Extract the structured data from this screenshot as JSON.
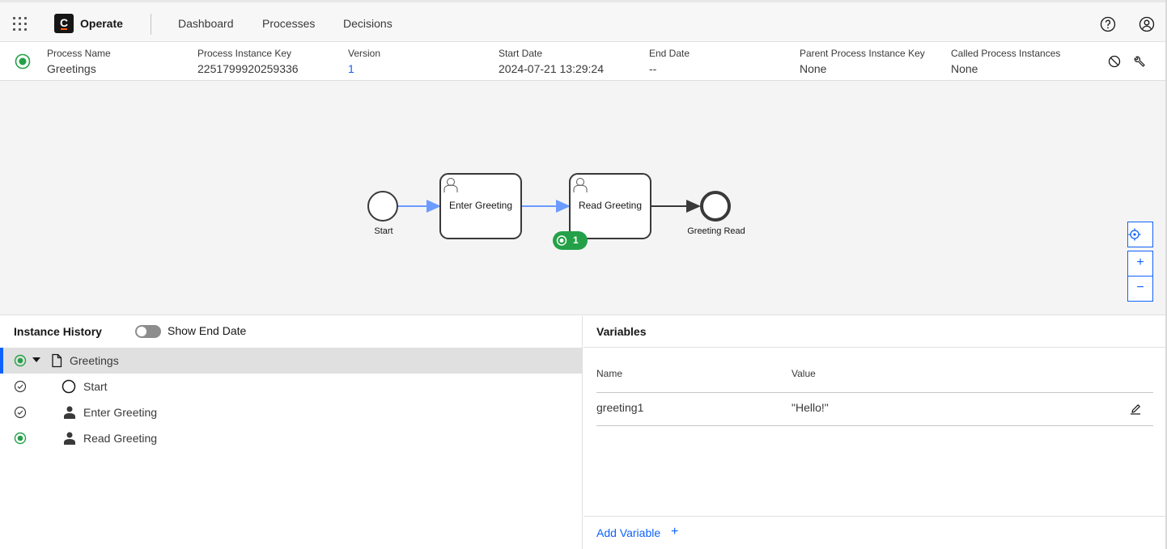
{
  "header": {
    "app_name": "Operate",
    "logo_letter": "C",
    "nav": [
      "Dashboard",
      "Processes",
      "Decisions"
    ],
    "icons": [
      "app-switcher-icon",
      "help-icon",
      "user-profile-icon"
    ]
  },
  "instance": {
    "status": "active",
    "fields": [
      {
        "label": "Process Name",
        "value": "Greetings"
      },
      {
        "label": "Process Instance Key",
        "value": "2251799920259336"
      },
      {
        "label": "Version",
        "value": "1"
      },
      {
        "label": "Start Date",
        "value": "2024-07-21 13:29:24"
      },
      {
        "label": "End Date",
        "value": "--"
      },
      {
        "label": "Parent Process Instance Key",
        "value": "None"
      },
      {
        "label": "Called Process Instances",
        "value": "None"
      }
    ],
    "actions": [
      "cancel-icon",
      "modify-icon"
    ]
  },
  "diagram": {
    "start_label": "Start",
    "task1_label": "Enter Greeting",
    "task2_label": "Read Greeting",
    "end_label": "Greeting Read",
    "active_badge_count": "1",
    "zoom_controls": [
      "reset-view-icon",
      "zoom-in-icon",
      "zoom-out-icon"
    ],
    "zoom_in_glyph": "+",
    "zoom_out_glyph": "−"
  },
  "history": {
    "title": "Instance History",
    "toggle_label": "Show End Date",
    "rows": [
      {
        "label": "Greetings",
        "status": "active"
      },
      {
        "label": "Start",
        "status": "completed"
      },
      {
        "label": "Enter Greeting",
        "status": "completed"
      },
      {
        "label": "Read Greeting",
        "status": "active"
      }
    ]
  },
  "variables": {
    "title": "Variables",
    "columns": [
      "Name",
      "Value"
    ],
    "rows": [
      {
        "name": "greeting1",
        "value": "\"Hello!\""
      }
    ],
    "add_label": "Add Variable",
    "add_glyph": "+"
  },
  "colors": {
    "active_green": "#24a148",
    "link_blue": "#0f62fe",
    "flow_blue": "#6b9bff"
  }
}
